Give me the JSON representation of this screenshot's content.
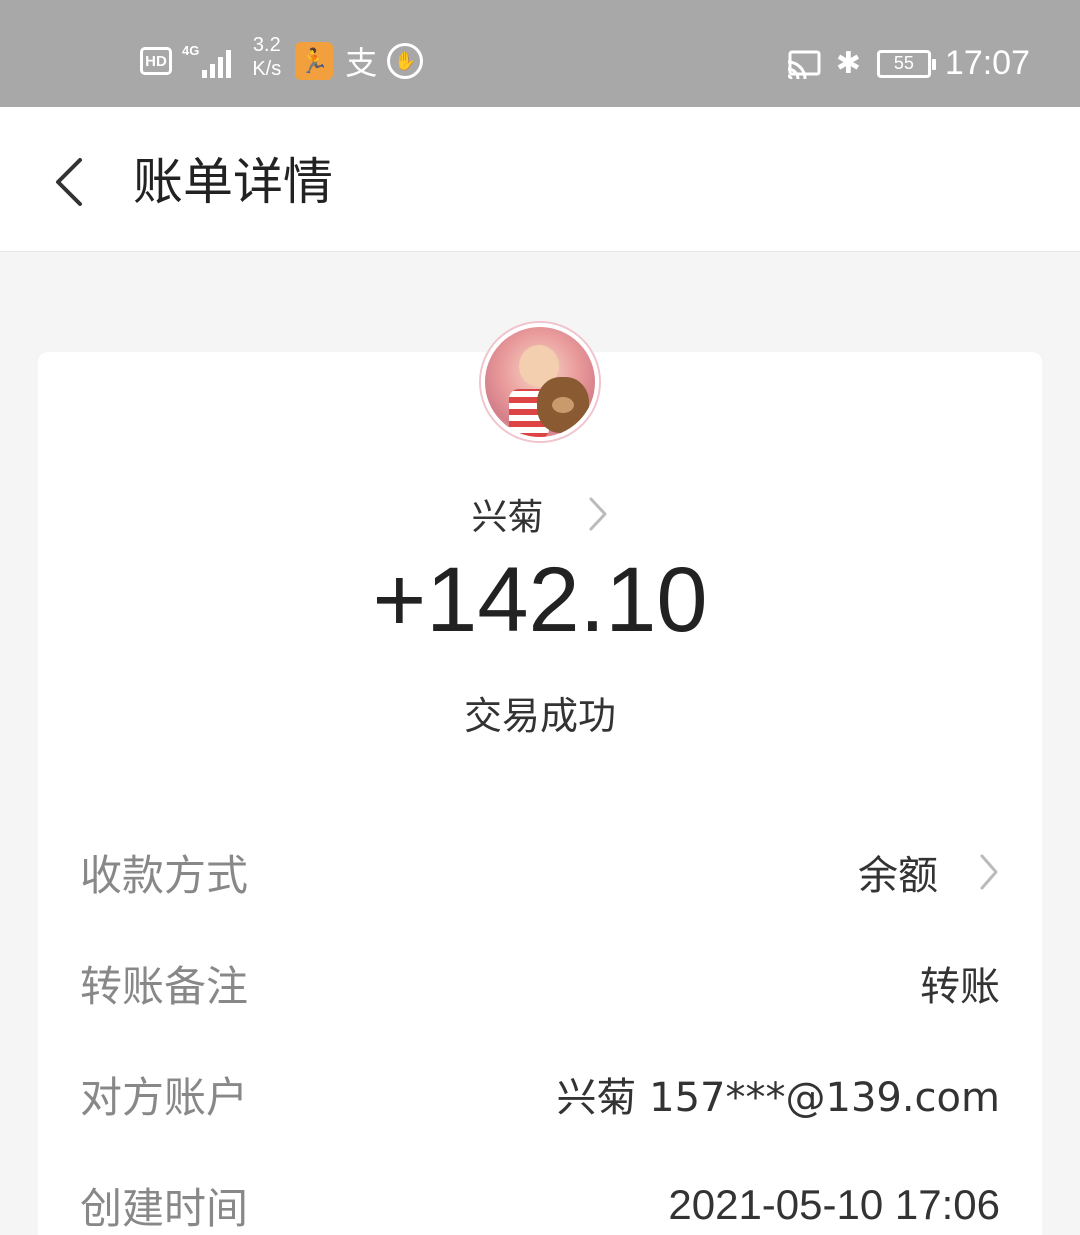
{
  "status_bar": {
    "hd": "HD",
    "network": "4G",
    "speed_value": "3.2",
    "speed_unit": "K/s",
    "app_icons": [
      "running-app-icon",
      "alipay-zhi-icon",
      "hand-icon"
    ],
    "right_icons": [
      "cast-icon",
      "bluetooth-icon",
      "battery-icon"
    ],
    "battery": "55",
    "time": "17:07"
  },
  "nav": {
    "back_icon": "chevron-left-icon",
    "title": "账单详情"
  },
  "header": {
    "name": "兴菊",
    "amount": "+142.10",
    "status": "交易成功"
  },
  "details": [
    {
      "label": "收款方式",
      "value": "余额",
      "has_arrow": true
    },
    {
      "label": "转账备注",
      "value": "转账",
      "has_arrow": false
    },
    {
      "label": "对方账户",
      "value": "兴菊 157***@139.com",
      "has_arrow": false
    },
    {
      "label": "创建时间",
      "value": "2021-05-10 17:06",
      "has_arrow": false
    }
  ],
  "colors": {
    "status_bar_bg": "#a8a8a8",
    "page_bg": "#f5f5f5",
    "label_text": "#888888",
    "value_text": "#333333"
  }
}
